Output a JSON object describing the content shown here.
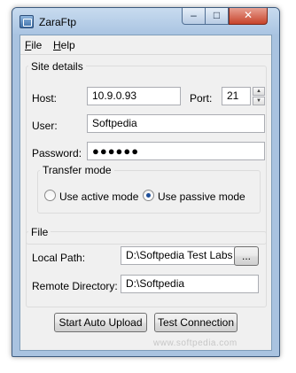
{
  "window": {
    "title": "ZaraFtp",
    "minimize_glyph": "–",
    "maximize_glyph": "□",
    "close_glyph": "✕"
  },
  "menu": {
    "file_key": "F",
    "file_rest": "ile",
    "help_key": "H",
    "help_rest": "elp"
  },
  "site_details": {
    "legend": "Site details",
    "host_label": "Host:",
    "host_value": "10.9.0.93",
    "port_label": "Port:",
    "port_value": "21",
    "user_label": "User:",
    "user_value": "Softpedia",
    "password_label": "Password:",
    "password_value": "●●●●●●"
  },
  "transfer_mode": {
    "legend": "Transfer mode",
    "active_label": "Use active mode",
    "passive_label": "Use passive mode",
    "selected": "passive"
  },
  "file": {
    "legend": "File",
    "local_path_label": "Local Path:",
    "local_path_value": "D:\\Softpedia Test Labs",
    "browse_label": "...",
    "remote_dir_label": "Remote Directory:",
    "remote_dir_value": "D:\\Softpedia"
  },
  "buttons": {
    "start_auto_upload": "Start Auto Upload",
    "test_connection": "Test Connection"
  },
  "watermark": "www.softpedia.com",
  "icons": {
    "app": "app-window-icon",
    "spin_up": "spin-up-icon",
    "spin_down": "spin-down-icon"
  }
}
